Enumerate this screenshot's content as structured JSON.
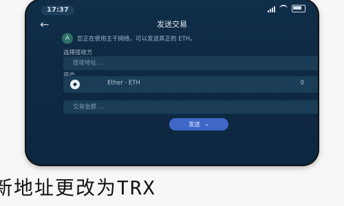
{
  "status": {
    "time": "17:37"
  },
  "nav": {
    "back_icon": "back-arrow-icon",
    "title": "发送交易"
  },
  "notice": {
    "badge": "A",
    "text": "您正在使用主干网络，可以发送真正的 ETH。"
  },
  "form": {
    "address_label": "选择接收方",
    "address_placeholder": "接收地址 ...",
    "asset_label": "资产",
    "asset": {
      "name": "Ether · ETH",
      "amount": "0"
    },
    "amount_placeholder": "交易金额 ..."
  },
  "send_button": {
    "label": "发送",
    "icon": "chevron-down-icon"
  },
  "overlay_text": "新地址更改为TRX",
  "colors": {
    "screen_bg": "#0e2a42",
    "field_bg": "#1b3c57",
    "button": "#3f67c7"
  }
}
